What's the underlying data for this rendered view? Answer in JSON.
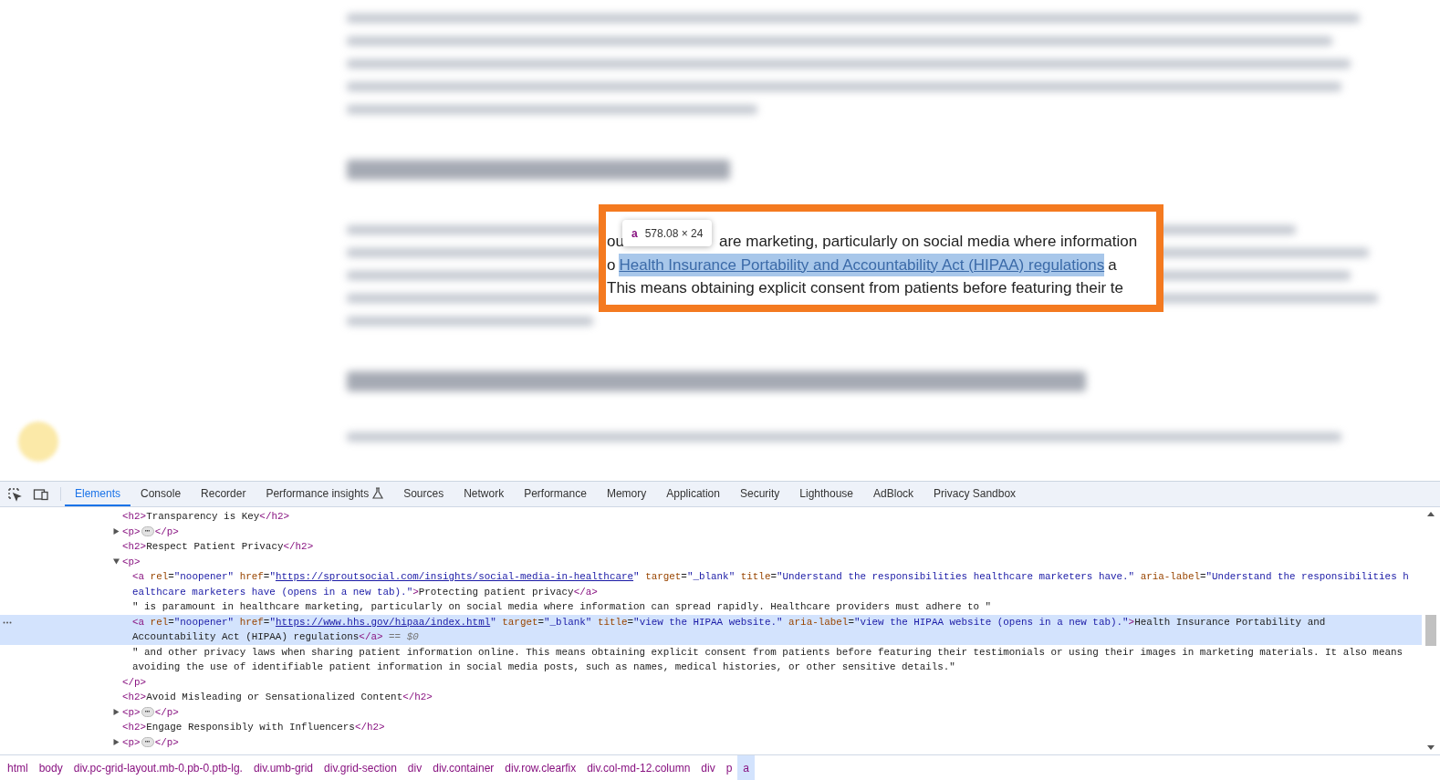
{
  "page": {
    "highlight": {
      "lines": [
        [
          {
            "kind": "text",
            "text": "ou"
          },
          {
            "kind": "gap"
          },
          {
            "kind": "text",
            "text": "are marketing, particularly on social media where information"
          }
        ],
        [
          {
            "kind": "text",
            "text": "o"
          },
          {
            "kind": "link",
            "text": "Health Insurance Portability and Accountability Act (HIPAA) regulations"
          },
          {
            "kind": "text",
            "text": "a"
          }
        ],
        [
          {
            "kind": "text",
            "text": "This means obtaining explicit consent from patients before featuring their te"
          }
        ]
      ],
      "tooltip": {
        "tag": "a",
        "size": "578.08 × 24"
      }
    }
  },
  "devtools": {
    "tabs": [
      {
        "label": "Elements",
        "selected": true,
        "experimental": false
      },
      {
        "label": "Console",
        "selected": false,
        "experimental": false
      },
      {
        "label": "Recorder",
        "selected": false,
        "experimental": false
      },
      {
        "label": "Performance insights",
        "selected": false,
        "experimental": true
      },
      {
        "label": "Sources",
        "selected": false,
        "experimental": false
      },
      {
        "label": "Network",
        "selected": false,
        "experimental": false
      },
      {
        "label": "Performance",
        "selected": false,
        "experimental": false
      },
      {
        "label": "Memory",
        "selected": false,
        "experimental": false
      },
      {
        "label": "Application",
        "selected": false,
        "experimental": false
      },
      {
        "label": "Security",
        "selected": false,
        "experimental": false
      },
      {
        "label": "Lighthouse",
        "selected": false,
        "experimental": false
      },
      {
        "label": "AdBlock",
        "selected": false,
        "experimental": false
      },
      {
        "label": "Privacy Sandbox",
        "selected": false,
        "experimental": false
      }
    ],
    "nodes": [
      {
        "selected": false,
        "lines": [
          [
            {
              "kind": "tag",
              "text": "<h2>"
            },
            {
              "kind": "text",
              "text": "Transparency is Key"
            },
            {
              "kind": "tag",
              "text": "</h2>"
            }
          ]
        ]
      },
      {
        "expanded": false,
        "selected": false,
        "lines": [
          [
            {
              "kind": "tag",
              "text": "<p>"
            },
            {
              "kind": "ellipsis",
              "text": "⋯"
            },
            {
              "kind": "tag",
              "text": "</p>"
            }
          ]
        ]
      },
      {
        "selected": false,
        "lines": [
          [
            {
              "kind": "tag",
              "text": "<h2>"
            },
            {
              "kind": "text",
              "text": "Respect Patient Privacy"
            },
            {
              "kind": "tag",
              "text": "</h2>"
            }
          ]
        ]
      },
      {
        "expanded": true,
        "selected": false,
        "lines": [
          [
            {
              "kind": "tag",
              "text": "<p>"
            }
          ]
        ],
        "close": [
          [
            {
              "kind": "tag",
              "text": "</p>"
            }
          ]
        ],
        "children": [
          {
            "selected": false,
            "lines": [
              [
                {
                  "kind": "tag",
                  "text": "<a"
                },
                {
                  "kind": "attr",
                  "text": " rel"
                },
                {
                  "kind": "text",
                  "text": "="
                },
                {
                  "kind": "value",
                  "text": "\"noopener\""
                },
                {
                  "kind": "attr",
                  "text": " href"
                },
                {
                  "kind": "text",
                  "text": "="
                },
                {
                  "kind": "value",
                  "text": "\""
                },
                {
                  "kind": "link",
                  "text": "https://sproutsocial.com/insights/social-media-in-healthcare"
                },
                {
                  "kind": "value",
                  "text": "\""
                },
                {
                  "kind": "attr",
                  "text": " target"
                },
                {
                  "kind": "text",
                  "text": "="
                },
                {
                  "kind": "value",
                  "text": "\"_blank\""
                },
                {
                  "kind": "attr",
                  "text": " title"
                },
                {
                  "kind": "text",
                  "text": "="
                },
                {
                  "kind": "value",
                  "text": "\"Understand the responsibilities healthcare marketers have.\""
                },
                {
                  "kind": "attr",
                  "text": " aria-label"
                },
                {
                  "kind": "text",
                  "text": "="
                },
                {
                  "kind": "value",
                  "text": "\"Understand the responsibilities h"
                }
              ],
              [
                {
                  "kind": "value",
                  "text": "ealthcare marketers have (opens in a new tab).\""
                },
                {
                  "kind": "tag",
                  "text": ">"
                },
                {
                  "kind": "text",
                  "text": "Protecting patient privacy"
                },
                {
                  "kind": "tag",
                  "text": "</a>"
                }
              ]
            ]
          },
          {
            "selected": false,
            "lines": [
              [
                {
                  "kind": "text",
                  "text": "\" is paramount in healthcare marketing, particularly on social media where information can spread rapidly. Healthcare providers must adhere to \""
                }
              ]
            ]
          },
          {
            "selected": true,
            "lines": [
              [
                {
                  "kind": "tag",
                  "text": "<a"
                },
                {
                  "kind": "attr",
                  "text": " rel"
                },
                {
                  "kind": "text",
                  "text": "="
                },
                {
                  "kind": "value",
                  "text": "\"noopener\""
                },
                {
                  "kind": "attr",
                  "text": " href"
                },
                {
                  "kind": "text",
                  "text": "="
                },
                {
                  "kind": "value",
                  "text": "\""
                },
                {
                  "kind": "link",
                  "text": "https://www.hhs.gov/hipaa/index.html"
                },
                {
                  "kind": "value",
                  "text": "\""
                },
                {
                  "kind": "attr",
                  "text": " target"
                },
                {
                  "kind": "text",
                  "text": "="
                },
                {
                  "kind": "value",
                  "text": "\"_blank\""
                },
                {
                  "kind": "attr",
                  "text": " title"
                },
                {
                  "kind": "text",
                  "text": "="
                },
                {
                  "kind": "value",
                  "text": "\"view the HIPAA website.\""
                },
                {
                  "kind": "attr",
                  "text": " aria-label"
                },
                {
                  "kind": "text",
                  "text": "="
                },
                {
                  "kind": "value",
                  "text": "\"view the HIPAA website (opens in a new tab).\""
                },
                {
                  "kind": "tag",
                  "text": ">"
                },
                {
                  "kind": "text",
                  "text": "Health Insurance Portability and"
                }
              ],
              [
                {
                  "kind": "text",
                  "text": "Accountability Act (HIPAA) regulations"
                },
                {
                  "kind": "tag",
                  "text": "</a>"
                },
                {
                  "kind": "marker",
                  "text": " == $0"
                }
              ]
            ]
          },
          {
            "selected": false,
            "lines": [
              [
                {
                  "kind": "text",
                  "text": "\" and other privacy laws when sharing patient information online. This means obtaining explicit consent from patients before featuring their testimonials or using their images in marketing materials. It also means"
                }
              ],
              [
                {
                  "kind": "text",
                  "text": "avoiding the use of identifiable patient information in social media posts, such as names, medical histories, or other sensitive details.\""
                }
              ]
            ]
          }
        ]
      },
      {
        "selected": false,
        "lines": [
          [
            {
              "kind": "tag",
              "text": "<h2>"
            },
            {
              "kind": "text",
              "text": "Avoid Misleading or Sensationalized Content"
            },
            {
              "kind": "tag",
              "text": "</h2>"
            }
          ]
        ]
      },
      {
        "expanded": false,
        "selected": false,
        "lines": [
          [
            {
              "kind": "tag",
              "text": "<p>"
            },
            {
              "kind": "ellipsis",
              "text": "⋯"
            },
            {
              "kind": "tag",
              "text": "</p>"
            }
          ]
        ]
      },
      {
        "selected": false,
        "lines": [
          [
            {
              "kind": "tag",
              "text": "<h2>"
            },
            {
              "kind": "text",
              "text": "Engage Responsibly with Influencers"
            },
            {
              "kind": "tag",
              "text": "</h2>"
            }
          ]
        ]
      },
      {
        "expanded": false,
        "selected": false,
        "lines": [
          [
            {
              "kind": "tag",
              "text": "<p>"
            },
            {
              "kind": "ellipsis",
              "text": "⋯"
            },
            {
              "kind": "tag",
              "text": "</p>"
            }
          ]
        ]
      }
    ],
    "breadcrumbs": [
      {
        "label": "html",
        "selected": false
      },
      {
        "label": "body",
        "selected": false
      },
      {
        "label": "div.pc-grid-layout.mb-0.pb-0.ptb-lg.",
        "selected": false
      },
      {
        "label": "div.umb-grid",
        "selected": false
      },
      {
        "label": "div.grid-section",
        "selected": false
      },
      {
        "label": "div",
        "selected": false
      },
      {
        "label": "div.container",
        "selected": false
      },
      {
        "label": "div.row.clearfix",
        "selected": false
      },
      {
        "label": "div.col-md-12.column",
        "selected": false
      },
      {
        "label": "div",
        "selected": false
      },
      {
        "label": "p",
        "selected": false
      },
      {
        "label": "a",
        "selected": true
      }
    ]
  }
}
